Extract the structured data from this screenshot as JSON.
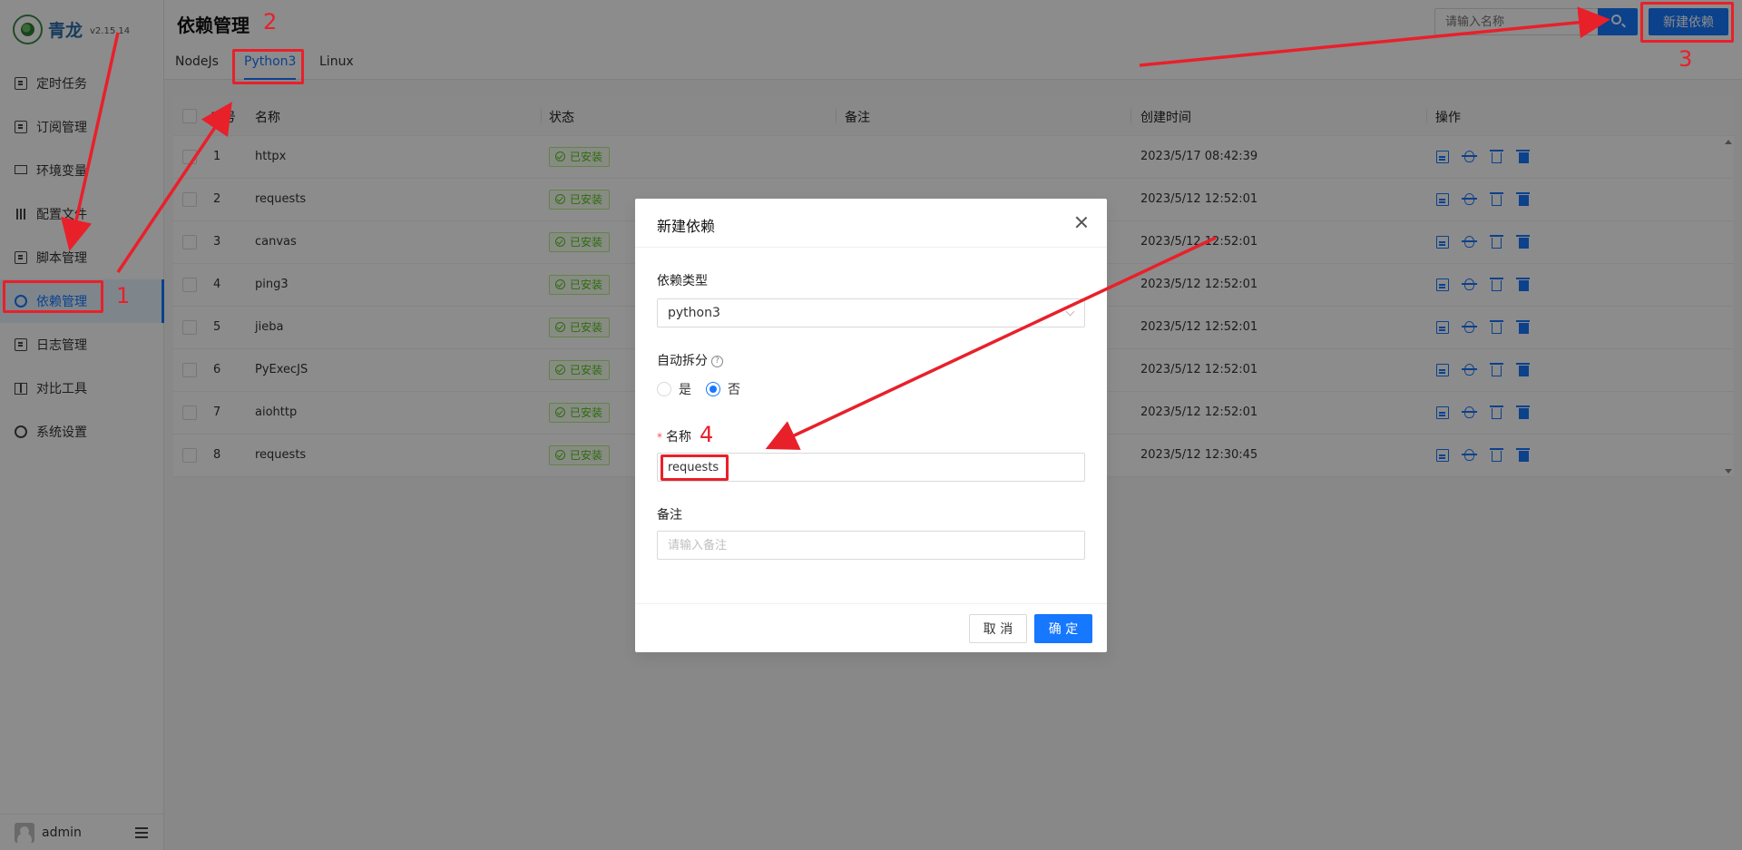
{
  "app": {
    "name": "青龙",
    "version": "v2.15.14"
  },
  "sidebar": {
    "items": [
      {
        "label": "定时任务",
        "icon": "clipboard-icon"
      },
      {
        "label": "订阅管理",
        "icon": "subscription-icon"
      },
      {
        "label": "环境变量",
        "icon": "monitor-icon"
      },
      {
        "label": "配置文件",
        "icon": "sliders-icon"
      },
      {
        "label": "脚本管理",
        "icon": "script-icon"
      },
      {
        "label": "依赖管理",
        "icon": "dependency-icon",
        "active": true
      },
      {
        "label": "日志管理",
        "icon": "log-icon"
      },
      {
        "label": "对比工具",
        "icon": "diff-icon"
      },
      {
        "label": "系统设置",
        "icon": "gear-icon"
      }
    ],
    "user": "admin"
  },
  "header": {
    "title": "依赖管理",
    "search_placeholder": "请输入名称",
    "create_label": "新建依赖"
  },
  "tabs": [
    {
      "label": "NodeJs",
      "active": false
    },
    {
      "label": "Python3",
      "active": true
    },
    {
      "label": "Linux",
      "active": false
    }
  ],
  "table": {
    "columns": [
      "序号",
      "名称",
      "状态",
      "备注",
      "创建时间",
      "操作"
    ],
    "rows": [
      {
        "index": "1",
        "name": "httpx",
        "status": "已安装",
        "remark": "",
        "created": "2023/5/17 08:42:39"
      },
      {
        "index": "2",
        "name": "requests",
        "status": "已安装",
        "remark": "",
        "created": "2023/5/12 12:52:01"
      },
      {
        "index": "3",
        "name": "canvas",
        "status": "已安装",
        "remark": "",
        "created": "2023/5/12 12:52:01"
      },
      {
        "index": "4",
        "name": "ping3",
        "status": "已安装",
        "remark": "",
        "created": "2023/5/12 12:52:01"
      },
      {
        "index": "5",
        "name": "jieba",
        "status": "已安装",
        "remark": "",
        "created": "2023/5/12 12:52:01"
      },
      {
        "index": "6",
        "name": "PyExecJS",
        "status": "已安装",
        "remark": "",
        "created": "2023/5/12 12:52:01"
      },
      {
        "index": "7",
        "name": "aiohttp",
        "status": "已安装",
        "remark": "",
        "created": "2023/5/12 12:52:01"
      },
      {
        "index": "8",
        "name": "requests",
        "status": "已安装",
        "remark": "",
        "created": "2023/5/12 12:30:45"
      }
    ]
  },
  "modal": {
    "title": "新建依赖",
    "type_label": "依赖类型",
    "type_value": "python3",
    "split_label": "自动拆分",
    "split_help": "?",
    "split_options": [
      {
        "label": "是",
        "checked": false
      },
      {
        "label": "否",
        "checked": true
      }
    ],
    "name_label": "名称",
    "name_value": "requests",
    "remark_label": "备注",
    "remark_placeholder": "请输入备注",
    "cancel_label": "取 消",
    "ok_label": "确 定"
  },
  "annotations": {
    "color": "#e8202a",
    "step1": "1",
    "step2": "2",
    "step3": "3",
    "step4": "4"
  },
  "colors": {
    "primary": "#1677ff",
    "success": "#52c41a",
    "annotation": "#e8202a"
  }
}
